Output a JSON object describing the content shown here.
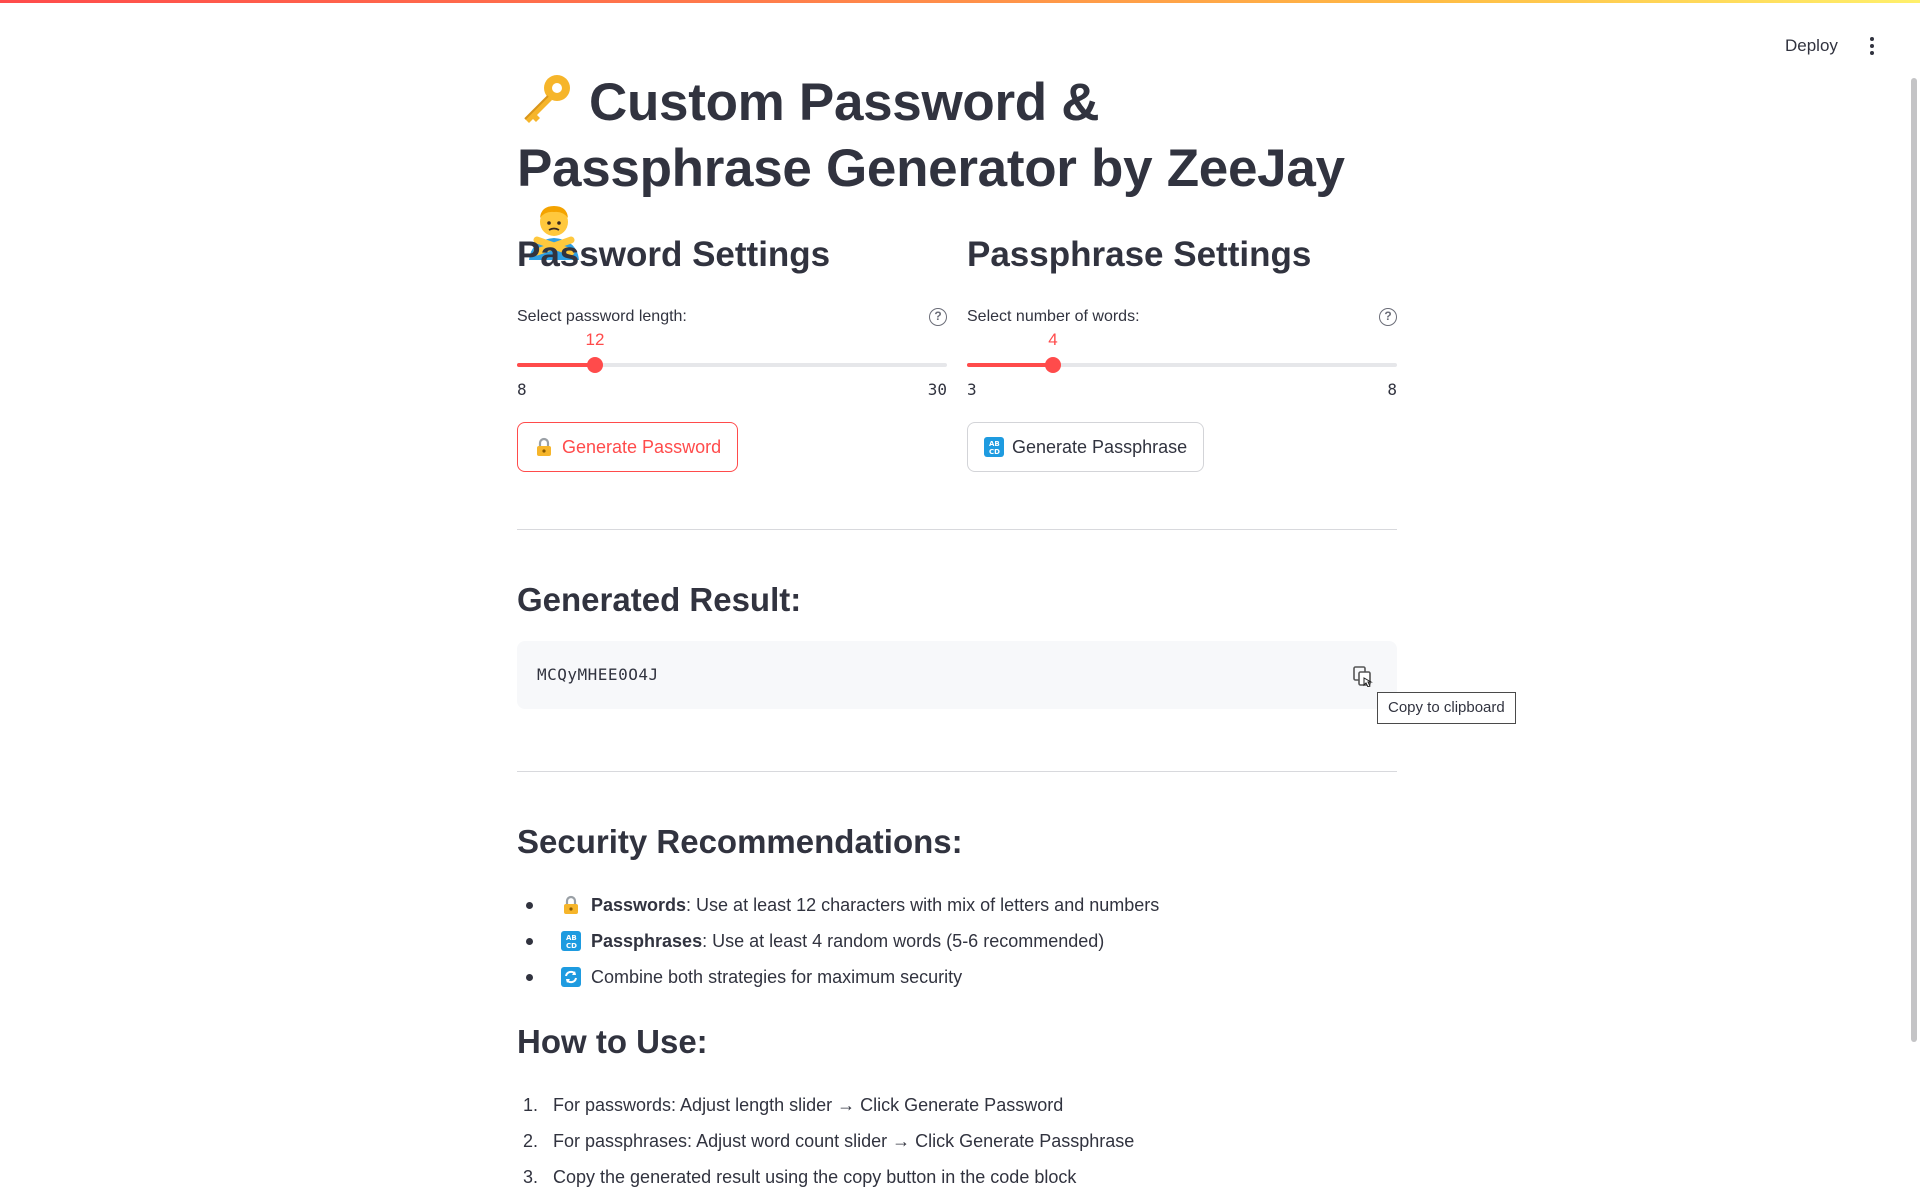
{
  "header": {
    "deploy_label": "Deploy"
  },
  "title": {
    "text": "Custom Password & Passphrase Generator by ZeeJay"
  },
  "password_settings": {
    "heading": "Password Settings",
    "slider_label": "Select password length:",
    "value": "12",
    "min": "8",
    "max": "30",
    "button_label": "Generate Password"
  },
  "passphrase_settings": {
    "heading": "Passphrase Settings",
    "slider_label": "Select number of words:",
    "value": "4",
    "min": "3",
    "max": "8",
    "button_label": "Generate Passphrase"
  },
  "result": {
    "heading": "Generated Result:",
    "code": "MCQyMHEE0O4J",
    "copy_tooltip": "Copy to clipboard"
  },
  "recommendations": {
    "heading": "Security Recommendations:",
    "items": [
      {
        "icon": "lock-icon",
        "bold": "Passwords",
        "text": ": Use at least 12 characters with mix of letters and numbers"
      },
      {
        "icon": "abcd-icon",
        "bold": "Passphrases",
        "text": ": Use at least 4 random words (5-6 recommended)"
      },
      {
        "icon": "refresh-icon",
        "bold": "",
        "text": "Combine both strategies for maximum security"
      }
    ]
  },
  "how_to": {
    "heading": "How to Use:",
    "steps": [
      {
        "num": "1.",
        "text": "For passwords: Adjust length slider → Click Generate Password"
      },
      {
        "num": "2.",
        "text": "For passphrases: Adjust word count slider → Click Generate Passphrase"
      },
      {
        "num": "3.",
        "text": "Copy the generated result using the copy button in the code block"
      }
    ]
  },
  "colors": {
    "accent": "#ff4b4b",
    "text": "#31333f",
    "code_bg": "#f7f8fa"
  }
}
